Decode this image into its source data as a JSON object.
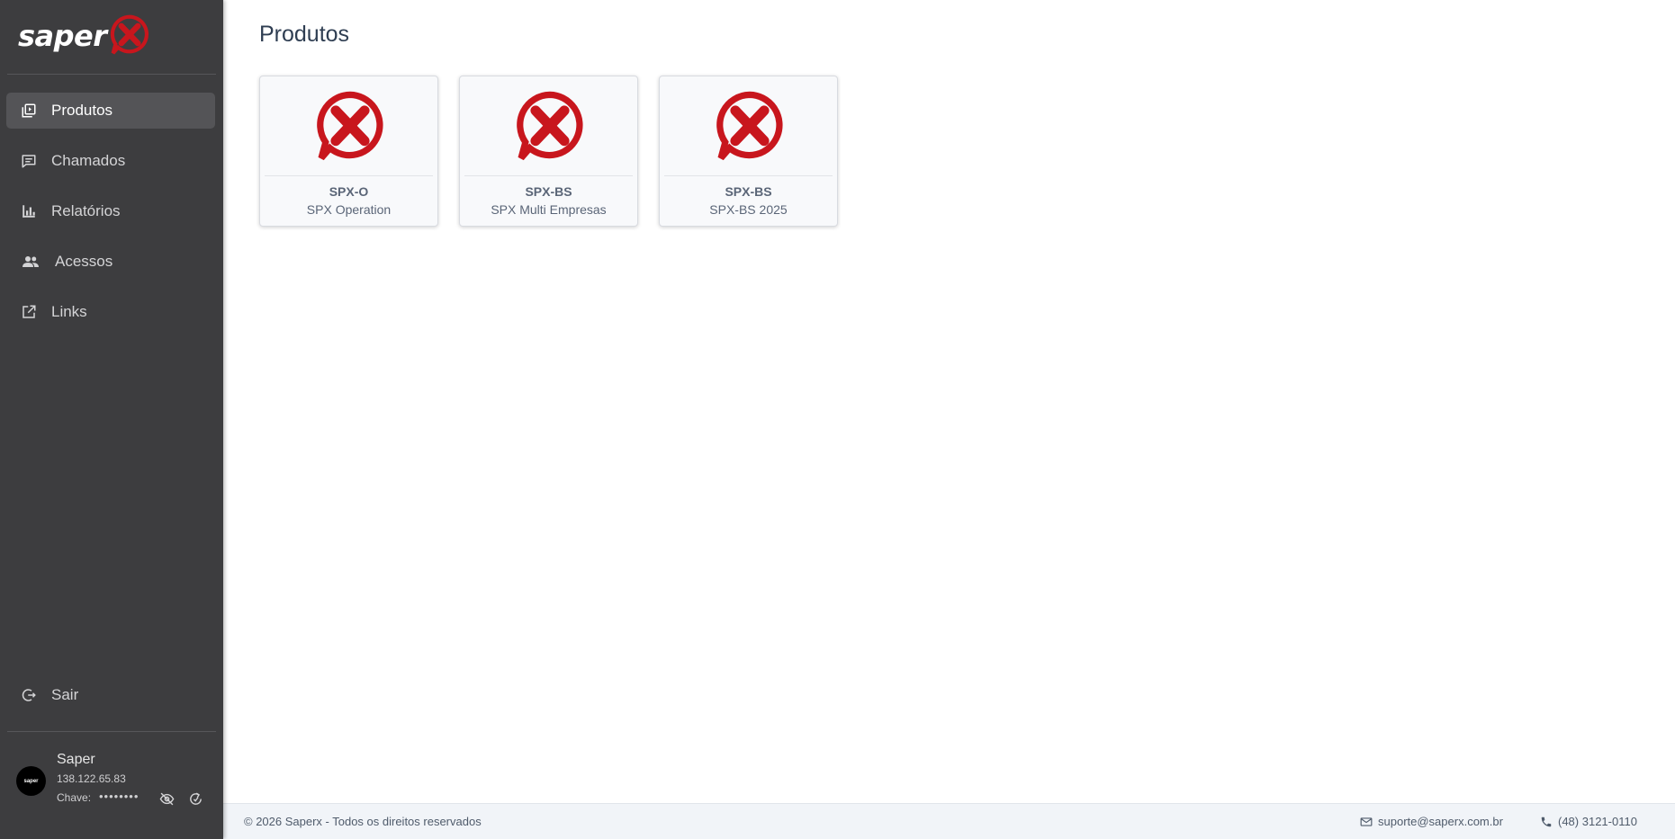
{
  "brand": {
    "wordmark": "saper"
  },
  "sidebar": {
    "items": [
      {
        "label": "Produtos",
        "icon": "library-icon"
      },
      {
        "label": "Chamados",
        "icon": "chat-icon"
      },
      {
        "label": "Relatórios",
        "icon": "bar-chart-icon"
      },
      {
        "label": "Acessos",
        "icon": "users-icon"
      },
      {
        "label": "Links",
        "icon": "external-link-icon"
      }
    ],
    "logout": {
      "label": "Sair",
      "icon": "logout-icon"
    }
  },
  "user": {
    "name": "Saper",
    "ip": "138.122.65.83",
    "key_label": "Chave:",
    "key_value": "••••••••"
  },
  "main": {
    "title": "Produtos",
    "products": [
      {
        "code": "SPX-O",
        "name": "SPX Operation"
      },
      {
        "code": "SPX-BS",
        "name": "SPX Multi Empresas"
      },
      {
        "code": "SPX-BS",
        "name": "SPX-BS 2025"
      }
    ]
  },
  "footer": {
    "copyright": "© 2026 Saperx - Todos os direitos reservados",
    "email": "suporte@saperx.com.br",
    "phone": "(48) 3121-0110"
  },
  "colors": {
    "sidebar_bg": "#3d3d3f",
    "sidebar_active": "#545457",
    "brand_red": "#c8161d",
    "title": "#2f3e52"
  }
}
